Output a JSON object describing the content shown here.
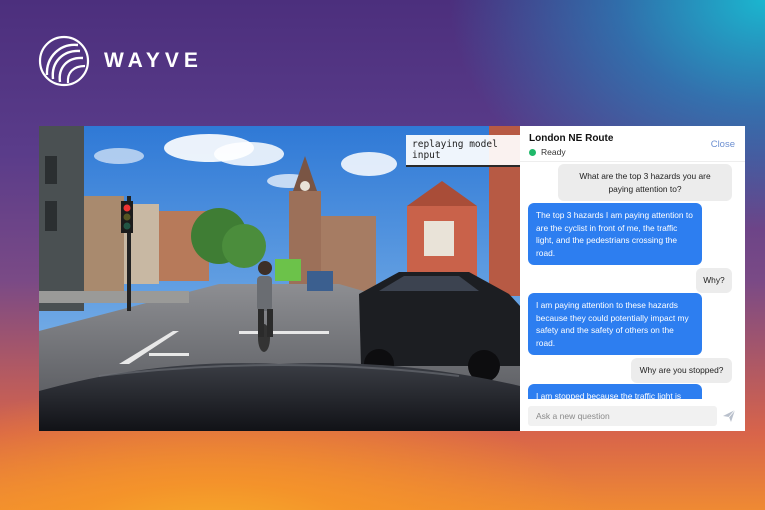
{
  "brand": {
    "name": "WAYVE",
    "logo_icon": "wayve-swirl-logo-icon"
  },
  "video": {
    "overlay_label": "replaying model input"
  },
  "chat": {
    "route_title": "London NE Route",
    "status_text": "Ready",
    "status_color": "#1fb86a",
    "close_label": "Close",
    "messages": [
      {
        "role": "user",
        "text": "What are the top 3 hazards you are paying attention to?"
      },
      {
        "role": "assistant",
        "text": "The top 3 hazards I am paying attention to are the cyclist in front of me, the traffic light, and the pedestrians crossing the road."
      },
      {
        "role": "user",
        "text": "Why?"
      },
      {
        "role": "assistant",
        "text": "I am paying attention to these hazards because they could potentially impact my safety and the safety of others on the road."
      },
      {
        "role": "user",
        "text": "Why are you stopped?"
      },
      {
        "role": "assistant",
        "text": "I am stopped because the traffic light is red."
      }
    ],
    "input_placeholder": "Ask a new question",
    "send_icon": "send-icon",
    "accent_color": "#2d7ef0"
  }
}
